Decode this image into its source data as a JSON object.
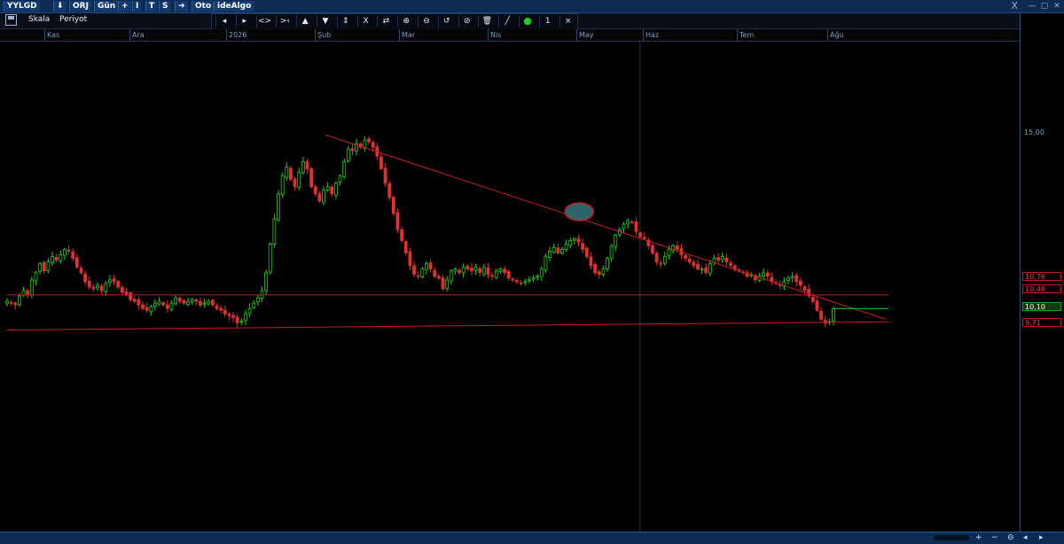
{
  "topbar": {
    "items": [
      "YYLGD",
      "⬇",
      "ORJ",
      "Gün",
      "+",
      "I",
      "T",
      "S",
      "➜",
      "Oto",
      "ideAlgo"
    ],
    "close_glyph": "X",
    "window_controls": [
      "—",
      "▢",
      "✕"
    ]
  },
  "toolbar": {
    "save_icon": "floppy-disk-icon",
    "scale_label": "Skala",
    "period_label": "Periyot",
    "tools": [
      "◂",
      "▸",
      "<>",
      ">‹",
      "▲",
      "▼",
      "⇕",
      "X",
      "⇄",
      "⊕",
      "⊖",
      "↺",
      "⊘",
      "🗑",
      "╱",
      "●",
      "1",
      "×"
    ],
    "tool_names": [
      "scroll-left-icon",
      "scroll-right-icon",
      "zoom-in-x-icon",
      "zoom-out-x-icon",
      "up-arrow-icon",
      "down-arrow-icon",
      "vertical-fit-icon",
      "x-cross-icon",
      "swap-icon",
      "plus-circle-icon",
      "minus-circle-icon",
      "refresh-icon",
      "no-icon",
      "trash-icon",
      "draw-line-icon",
      "color-dot-icon",
      "line-width",
      "close-icon"
    ],
    "dot_color": "#19d219"
  },
  "xaxis": {
    "labels": [
      "Kas",
      "Ara",
      "2026",
      "Şub",
      "Mar",
      "Nis",
      "May",
      "Haz",
      "Tem",
      "Ağu"
    ]
  },
  "yaxis": {
    "labels": [
      "15,00"
    ]
  },
  "price_tags": [
    {
      "value": "10,76",
      "color": "#ff3b3b",
      "border": "#c01a1a"
    },
    {
      "value": "10,48",
      "color": "#ff3b3b",
      "border": "#c01a1a"
    },
    {
      "value": "10,10",
      "color": "#ffffff",
      "border": "#1fa11f"
    },
    {
      "value": "9,71",
      "color": "#ff3b3b",
      "border": "#c01a1a"
    }
  ],
  "bottombar": {
    "buttons": [
      "+",
      "−",
      "⊖",
      "◂",
      "▸"
    ]
  },
  "chart_data": {
    "type": "candlestick",
    "x_range": [
      "2025-10-15",
      "2026-08-10"
    ],
    "ylim": [
      8.0,
      16.8
    ],
    "up_color": "#19d219",
    "down_color": "#e03030",
    "annotation_color": "#c81e1e",
    "series": [
      {
        "name": "",
        "values": [
          10.3,
          10.25,
          10.2,
          10.45,
          10.6,
          10.5,
          10.9,
          11.1,
          11.35,
          11.15,
          11.4,
          11.55,
          11.45,
          11.6,
          11.75,
          11.7,
          11.5,
          11.25,
          11.1,
          10.85,
          10.7,
          10.65,
          10.75,
          10.6,
          10.8,
          10.9,
          10.85,
          10.7,
          10.55,
          10.5,
          10.35,
          10.3,
          10.2,
          10.1,
          10.05,
          10.15,
          10.25,
          10.3,
          10.2,
          10.1,
          10.25,
          10.4,
          10.3,
          10.25,
          10.3,
          10.35,
          10.3,
          10.2,
          10.25,
          10.3,
          10.2,
          10.1,
          10.05,
          9.95,
          9.9,
          9.85,
          9.7,
          9.75,
          9.95,
          10.1,
          10.25,
          10.4,
          10.6,
          11.1,
          11.9,
          12.6,
          13.3,
          13.8,
          14.05,
          13.7,
          13.5,
          13.9,
          14.2,
          14.0,
          13.5,
          13.3,
          13.1,
          13.4,
          13.5,
          13.3,
          13.6,
          13.8,
          14.2,
          14.55,
          14.5,
          14.7,
          14.6,
          14.8,
          14.75,
          14.6,
          14.35,
          14.0,
          13.6,
          13.2,
          12.75,
          12.3,
          12.0,
          11.65,
          11.3,
          11.05,
          11.0,
          11.2,
          11.35,
          11.2,
          11.0,
          10.95,
          10.65,
          10.9,
          11.15,
          11.2,
          11.1,
          11.25,
          11.2,
          11.15,
          11.25,
          11.1,
          11.25,
          11.05,
          11.0,
          11.15,
          11.2,
          11.1,
          10.95,
          10.9,
          10.85,
          10.8,
          10.85,
          10.9,
          10.95,
          11.0,
          11.2,
          11.55,
          11.7,
          11.8,
          11.65,
          11.75,
          11.9,
          12.0,
          12.05,
          11.95,
          11.75,
          11.55,
          11.3,
          11.1,
          11.05,
          11.2,
          11.5,
          11.85,
          12.15,
          12.3,
          12.45,
          12.55,
          12.5,
          12.25,
          12.1,
          12.05,
          11.85,
          11.65,
          11.4,
          11.35,
          11.55,
          11.75,
          11.85,
          11.75,
          11.6,
          11.5,
          11.4,
          11.3,
          11.2,
          11.2,
          11.1,
          11.35,
          11.5,
          11.45,
          11.55,
          11.4,
          11.3,
          11.2,
          11.15,
          11.1,
          11.0,
          11.05,
          10.9,
          11.0,
          11.1,
          11.0,
          10.85,
          10.8,
          10.75,
          10.85,
          10.95,
          11.0,
          10.85,
          10.75,
          10.6,
          10.45,
          10.3,
          10.05,
          9.8,
          9.7,
          9.73,
          10.1
        ]
      }
    ],
    "trendlines": [
      {
        "name": "resistance-line",
        "from": [
          "2026-02-07",
          14.95
        ],
        "to": [
          "2026-08-29",
          9.8
        ],
        "color": "#c81e1e"
      },
      {
        "name": "support-line",
        "from": [
          "2025-10-15",
          9.5
        ],
        "to": [
          "2026-08-30",
          9.73
        ],
        "color": "#c81e1e"
      },
      {
        "name": "horizontal-support",
        "from": [
          "2025-10-15",
          10.48
        ],
        "to": [
          "2026-08-30",
          10.48
        ],
        "color": "#c81e1e"
      },
      {
        "name": "current-price",
        "from": [
          "2026-08-10",
          10.1
        ],
        "to": [
          "2026-08-30",
          10.1
        ],
        "color": "#19d219"
      }
    ],
    "vertical_marker": {
      "date": "2026-06-01",
      "color": "#1c2a80"
    },
    "highlight_ellipse": {
      "date": "2026-05-10",
      "value": 12.8
    }
  }
}
